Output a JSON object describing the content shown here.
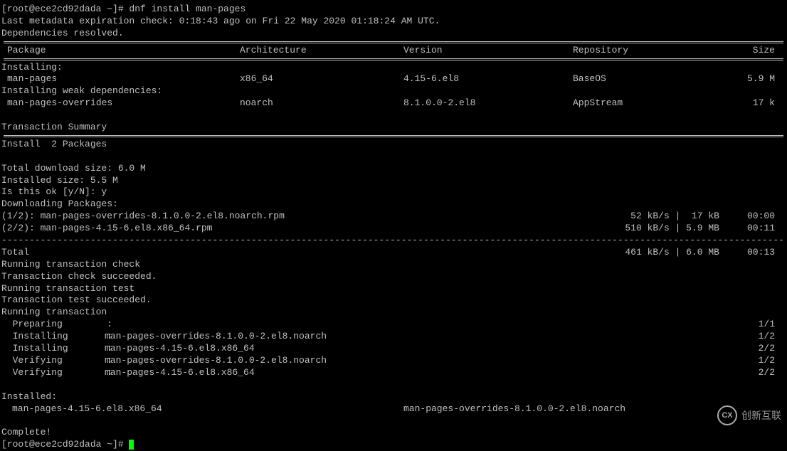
{
  "prompt1": "[root@ece2cd92dada ~]# dnf install man-pages",
  "meta_check": "Last metadata expiration check: 0:18:43 ago on Fri 22 May 2020 01:18:24 AM UTC.",
  "deps_resolved": "Dependencies resolved.",
  "headers": {
    "package": " Package",
    "arch": "Architecture",
    "version": "Version",
    "repo": "Repository",
    "size": "Size"
  },
  "installing_label": "Installing:",
  "installing_weak_label": "Installing weak dependencies:",
  "packages": [
    {
      "name": " man-pages",
      "arch": "x86_64",
      "version": "4.15-6.el8",
      "repo": "BaseOS",
      "size": "5.9 M"
    },
    {
      "name": " man-pages-overrides",
      "arch": "noarch",
      "version": "8.1.0.0-2.el8",
      "repo": "AppStream",
      "size": "17 k"
    }
  ],
  "trans_summary": "Transaction Summary",
  "install_count": "Install  2 Packages",
  "dl_size": "Total download size: 6.0 M",
  "inst_size": "Installed size: 5.5 M",
  "confirm": "Is this ok [y/N]: y",
  "dl_label": "Downloading Packages:",
  "downloads": [
    {
      "left": "(1/2): man-pages-overrides-8.1.0.0-2.el8.noarch.rpm",
      "right": " 52 kB/s |  17 kB     00:00"
    },
    {
      "left": "(2/2): man-pages-4.15-6.el8.x86_64.rpm",
      "right": "510 kB/s | 5.9 MB     00:11"
    }
  ],
  "total": {
    "left": "Total",
    "right": "461 kB/s | 6.0 MB     00:13"
  },
  "running_check": "Running transaction check",
  "check_ok": "Transaction check succeeded.",
  "running_test": "Running transaction test",
  "test_ok": "Transaction test succeeded.",
  "running_trans": "Running transaction",
  "trans_steps": [
    {
      "action": "  Preparing        :",
      "pkg": "",
      "count": "1/1"
    },
    {
      "action": "  Installing       :",
      "pkg": "man-pages-overrides-8.1.0.0-2.el8.noarch",
      "count": "1/2"
    },
    {
      "action": "  Installing       :",
      "pkg": "man-pages-4.15-6.el8.x86_64",
      "count": "2/2"
    },
    {
      "action": "  Verifying        :",
      "pkg": "man-pages-overrides-8.1.0.0-2.el8.noarch",
      "count": "1/2"
    },
    {
      "action": "  Verifying        :",
      "pkg": "man-pages-4.15-6.el8.x86_64",
      "count": "2/2"
    }
  ],
  "installed_label": "Installed:",
  "installed": [
    "man-pages-4.15-6.el8.x86_64",
    "man-pages-overrides-8.1.0.0-2.el8.noarch"
  ],
  "complete": "Complete!",
  "prompt2": "[root@ece2cd92dada ~]# ",
  "watermark": "创新互联"
}
